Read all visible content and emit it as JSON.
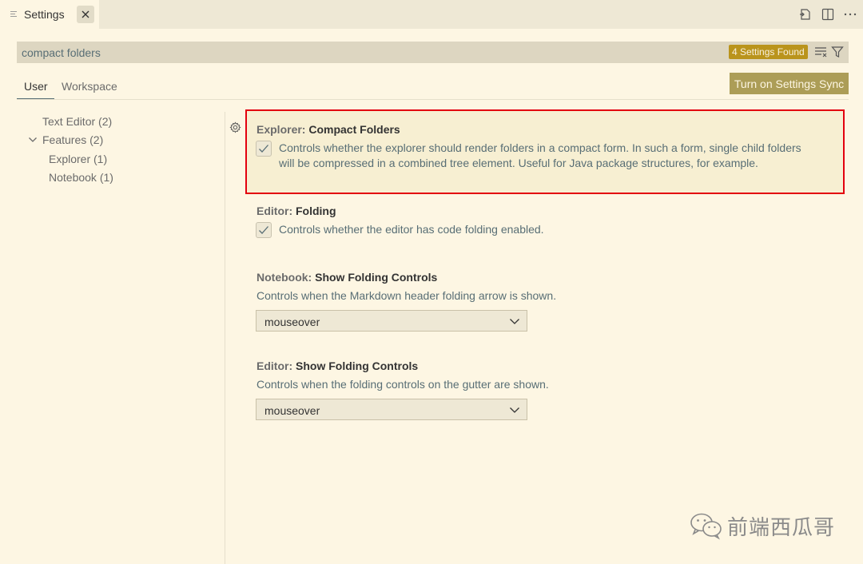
{
  "tab": {
    "title": "Settings"
  },
  "search": {
    "value": "compact folders",
    "count_badge": "4 Settings Found"
  },
  "scope_tabs": [
    {
      "label": "User"
    },
    {
      "label": "Workspace"
    }
  ],
  "sync_button": "Turn on Settings Sync",
  "toc": [
    {
      "label": "Text Editor (2)"
    },
    {
      "label": "Features (2)"
    },
    {
      "label": "Explorer (1)"
    },
    {
      "label": "Notebook (1)"
    }
  ],
  "settings": [
    {
      "category": "Explorer: ",
      "name": "Compact Folders",
      "desc_line1": "Controls whether the explorer should render folders in a compact form. In such a form, single child folders",
      "desc_line2": "will be compressed in a combined tree element. Useful for Java package structures, for example.",
      "checked": true
    },
    {
      "category": "Editor: ",
      "name": "Folding",
      "desc_line1": "Controls whether the editor has code folding enabled.",
      "checked": true
    },
    {
      "category": "Notebook: ",
      "name": "Show Folding Controls",
      "desc_line1": "Controls when the Markdown header folding arrow is shown.",
      "value": "mouseover"
    },
    {
      "category": "Editor: ",
      "name": "Show Folding Controls",
      "desc_line1": "Controls when the folding controls on the gutter are shown.",
      "value": "mouseover"
    }
  ],
  "watermark": {
    "text": "前端西瓜哥"
  },
  "colors": {
    "accent": "#b58900",
    "highlight_border": "#e3000f",
    "background": "#fdf6e3"
  }
}
